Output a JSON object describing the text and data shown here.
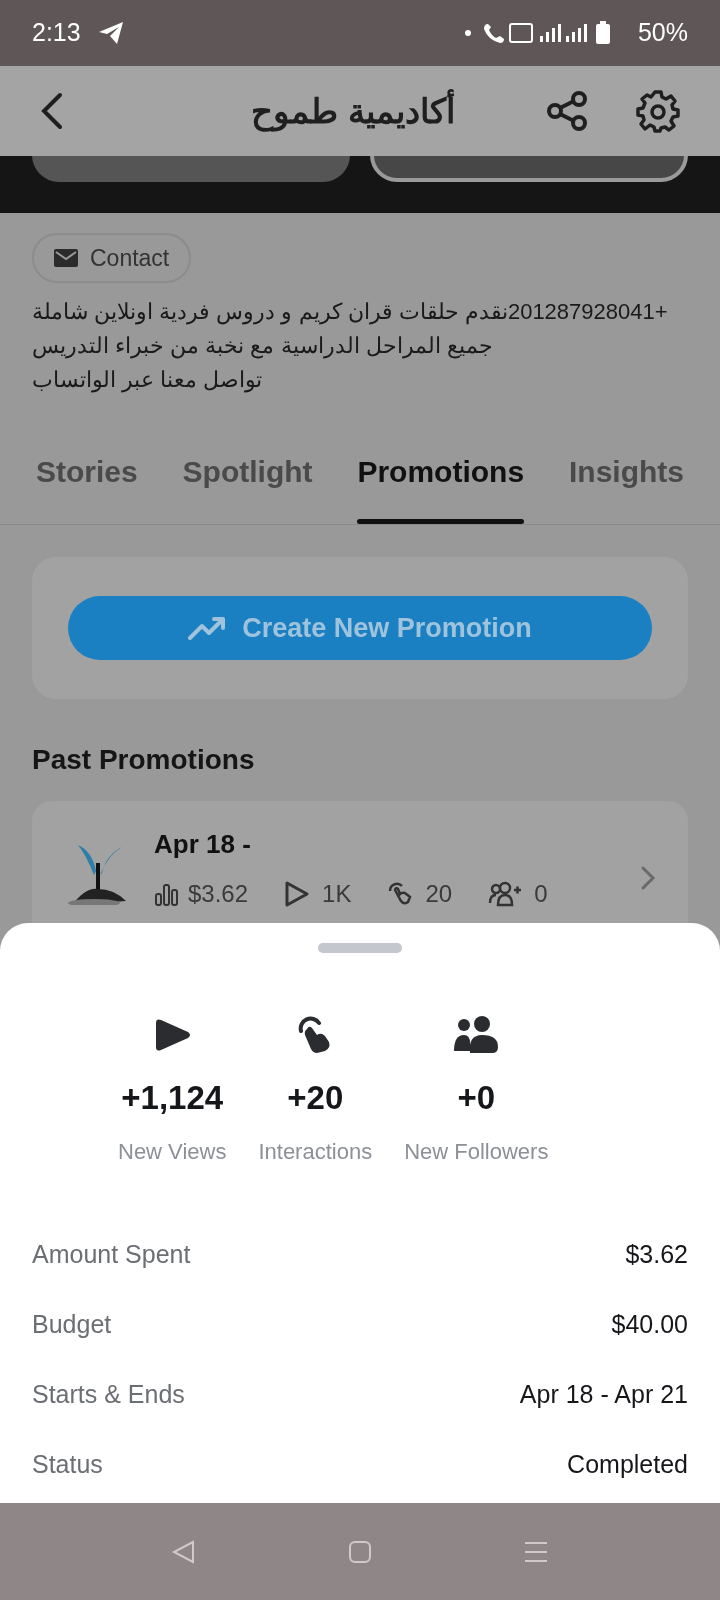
{
  "status_bar": {
    "time": "2:13",
    "battery": "50%"
  },
  "header": {
    "title": "أكاديمية طموح"
  },
  "contact": {
    "label": "Contact"
  },
  "bio": [
    "+201287928041نقدم حلقات قران كريم و دروس فردية اونلاين شاملة",
    "جميع المراحل الدراسية مع نخبة من خبراء التدريس",
    "تواصل معنا عبر الواتساب"
  ],
  "tabs": [
    {
      "label": "Stories",
      "selected": false
    },
    {
      "label": "Spotlight",
      "selected": false
    },
    {
      "label": "Promotions",
      "selected": true
    },
    {
      "label": "Insights",
      "selected": false
    }
  ],
  "create_button": {
    "label": "Create New Promotion"
  },
  "past_promotions": {
    "title": "Past Promotions",
    "items": [
      {
        "date": "Apr 18 -",
        "spent": "$3.62",
        "views": "1K",
        "interactions": "20",
        "followers": "0"
      }
    ]
  },
  "sheet": {
    "stats": [
      {
        "kind": "views",
        "value": "+1,124",
        "label": "New Views"
      },
      {
        "kind": "interactions",
        "value": "+20",
        "label": "Interactions"
      },
      {
        "kind": "followers",
        "value": "+0",
        "label": "New Followers"
      }
    ],
    "details": [
      {
        "label": "Amount Spent",
        "value": "$3.62"
      },
      {
        "label": "Budget",
        "value": "$40.00"
      },
      {
        "label": "Starts & Ends",
        "value": "Apr 18 - Apr 21"
      },
      {
        "label": "Status",
        "value": "Completed"
      }
    ]
  }
}
